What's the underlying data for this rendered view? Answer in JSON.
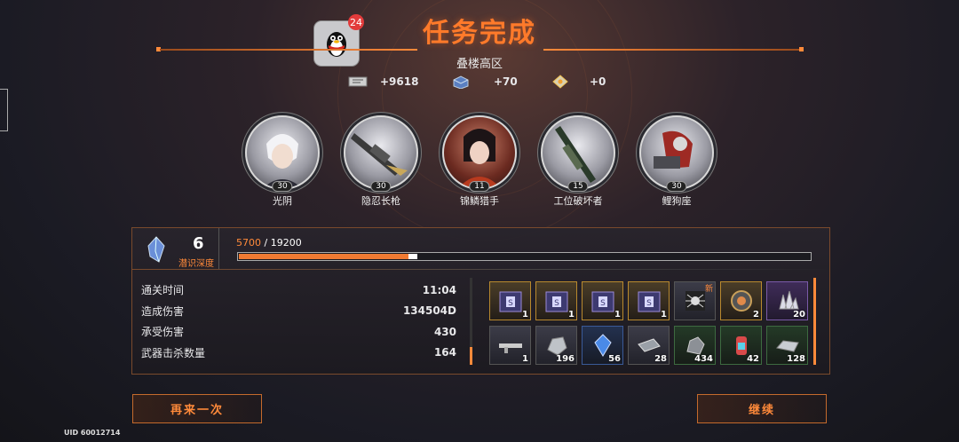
{
  "header": {
    "title": "任务完成",
    "zone": "叠楼高区"
  },
  "qq": {
    "icon": "qq-penguin-icon",
    "notifications": "24"
  },
  "rewards": [
    {
      "icon": "ticket-icon",
      "value": "+9618"
    },
    {
      "icon": "crystal-box-icon",
      "value": "+70"
    },
    {
      "icon": "diamond-icon",
      "value": "+0"
    }
  ],
  "characters": [
    {
      "name": "光阴",
      "level": "30"
    },
    {
      "name": "隐忍长枪",
      "level": "30"
    },
    {
      "name": "锦鳞猎手",
      "level": "11"
    },
    {
      "name": "工位破坏者",
      "level": "15"
    },
    {
      "name": "鲤狗座",
      "level": "30"
    }
  ],
  "depth": {
    "value": "6",
    "label": "潜识深度",
    "progress_current": "5700",
    "progress_total": "/ 19200",
    "progress_fraction": 0.297
  },
  "stats": [
    {
      "label": "通关时间",
      "value": "11:04"
    },
    {
      "label": "造成伤害",
      "value": "134504D"
    },
    {
      "label": "承受伤害",
      "value": "430"
    },
    {
      "label": "武器击杀数量",
      "value": "164"
    }
  ],
  "items": [
    {
      "icon": "loot-box-icon",
      "qty": "1",
      "rarity": "gold",
      "new": ""
    },
    {
      "icon": "loot-box-icon",
      "qty": "1",
      "rarity": "gold",
      "new": ""
    },
    {
      "icon": "loot-box-icon",
      "qty": "1",
      "rarity": "gold",
      "new": ""
    },
    {
      "icon": "loot-box-icon",
      "qty": "1",
      "rarity": "gold",
      "new": ""
    },
    {
      "icon": "spider-chip-icon",
      "qty": "",
      "rarity": "plain",
      "new": "新"
    },
    {
      "icon": "gear-core-icon",
      "qty": "2",
      "rarity": "gold",
      "new": ""
    },
    {
      "icon": "crystal-cluster-icon",
      "qty": "20",
      "rarity": "purple",
      "new": ""
    },
    {
      "icon": "rifle-icon",
      "qty": "1",
      "rarity": "plain",
      "new": ""
    },
    {
      "icon": "ore-icon",
      "qty": "196",
      "rarity": "plain",
      "new": ""
    },
    {
      "icon": "blue-crystal-icon",
      "qty": "56",
      "rarity": "blue",
      "new": ""
    },
    {
      "icon": "metal-plate-icon",
      "qty": "28",
      "rarity": "plain",
      "new": ""
    },
    {
      "icon": "rock-icon",
      "qty": "434",
      "rarity": "green",
      "new": ""
    },
    {
      "icon": "canister-icon",
      "qty": "42",
      "rarity": "green",
      "new": ""
    },
    {
      "icon": "ingot-icon",
      "qty": "128",
      "rarity": "green",
      "new": ""
    }
  ],
  "buttons": {
    "retry": "再来一次",
    "continue": "继续"
  },
  "uid": "UID 60012714"
}
